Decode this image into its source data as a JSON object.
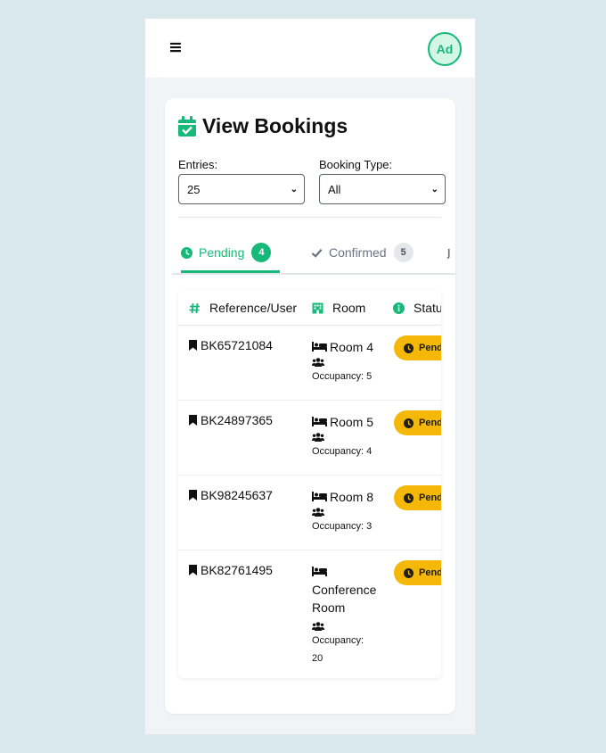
{
  "header": {
    "menu_icon": "≡",
    "avatar_initials": "Ad"
  },
  "page": {
    "title": "View Bookings"
  },
  "filters": {
    "entries_label": "Entries:",
    "entries_value": "25",
    "type_label": "Booking Type:",
    "type_value": "All"
  },
  "tabs": [
    {
      "label": "Pending",
      "count": "4",
      "icon": "clock-icon"
    },
    {
      "label": "Confirmed",
      "count": "5",
      "icon": "check-icon"
    }
  ],
  "table": {
    "columns": [
      "Reference/User",
      "Room",
      "Statu"
    ],
    "rows": [
      {
        "ref": "BK65721084",
        "room": "Room 4",
        "occupancy": "Occupancy: 5",
        "status": "Pend"
      },
      {
        "ref": "BK24897365",
        "room": "Room 5",
        "occupancy": "Occupancy: 4",
        "status": "Pend"
      },
      {
        "ref": "BK98245637",
        "room": "Room 8",
        "occupancy": "Occupancy: 3",
        "status": "Pend"
      },
      {
        "ref": "BK82761495",
        "room": "Conference Room",
        "occupancy": "Occupancy: 20",
        "status": "Pend"
      }
    ]
  },
  "colors": {
    "accent": "#16b979",
    "pending": "#f6b808"
  }
}
